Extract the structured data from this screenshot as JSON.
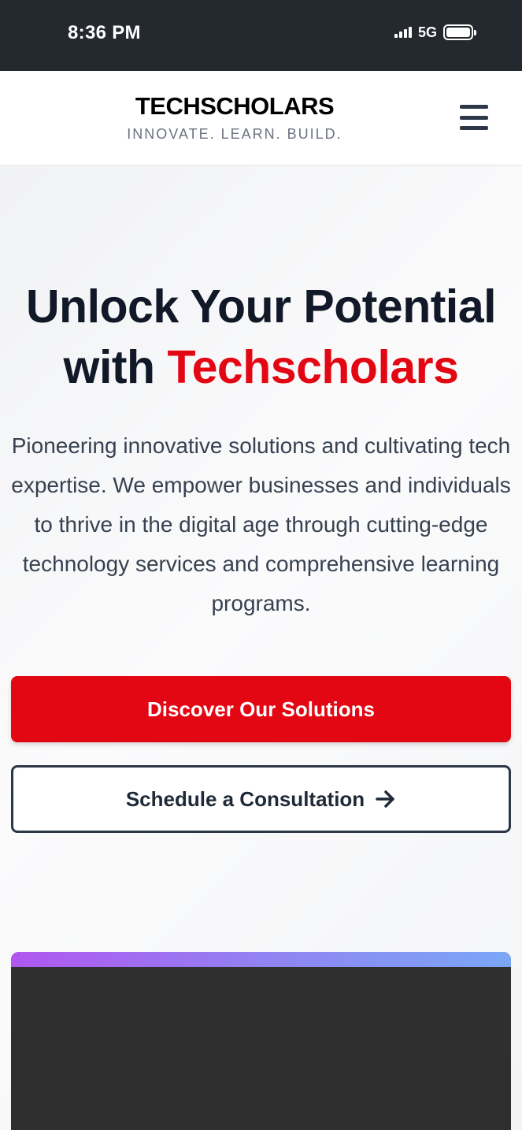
{
  "status_bar": {
    "time": "8:36 PM",
    "network": "5G"
  },
  "header": {
    "brand_name": "TECHSCHOLARS",
    "tagline": "INNOVATE. LEARN. BUILD.",
    "menu_icon": "hamburger-menu-icon"
  },
  "hero": {
    "title_line1": "Unlock Your Potential",
    "title_with": "with",
    "title_accent": "Techscholars",
    "description": "Pioneering innovative solutions and cultivating tech expertise. We empower businesses and individuals to thrive in the digital age through cutting-edge technology services and comprehensive learning programs.",
    "primary_button": "Discover Our Solutions",
    "secondary_button": "Schedule a Consultation",
    "secondary_icon": "arrow-right-icon"
  },
  "colors": {
    "accent": "#e30613",
    "dark_text": "#111827",
    "status_bar": "#24292f",
    "gradient_start": "#b057f0",
    "gradient_end": "#7aa7f6"
  }
}
